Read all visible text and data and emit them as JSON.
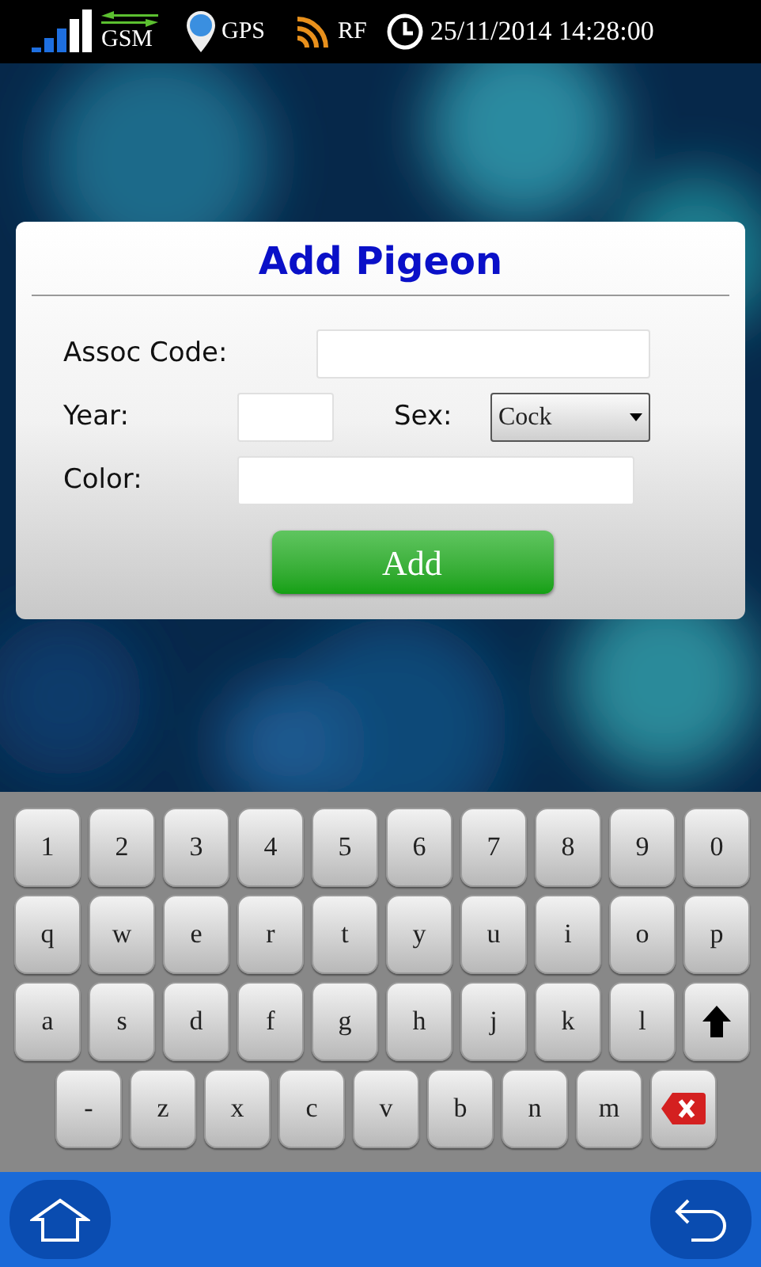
{
  "status_bar": {
    "network": "GSM",
    "gps": "GPS",
    "rf": "RF",
    "datetime": "25/11/2014 14:28:00"
  },
  "dialog": {
    "title": "Add Pigeon",
    "fields": [
      {
        "kind": "text",
        "label": "Assoc Code:"
      },
      {
        "kind": "year",
        "label": "Year:"
      },
      {
        "kind": "select",
        "label": "Sex:",
        "value": "Cock"
      },
      {
        "kind": "text",
        "label": "Color:"
      }
    ],
    "button": "Add"
  },
  "keyboard": {
    "rows": [
      [
        {
          "kind": "char",
          "label": "1"
        },
        {
          "kind": "char",
          "label": "2"
        },
        {
          "kind": "char",
          "label": "3"
        },
        {
          "kind": "char",
          "label": "4"
        },
        {
          "kind": "char",
          "label": "5"
        },
        {
          "kind": "char",
          "label": "6"
        },
        {
          "kind": "char",
          "label": "7"
        },
        {
          "kind": "char",
          "label": "8"
        },
        {
          "kind": "char",
          "label": "9"
        },
        {
          "kind": "char",
          "label": "0"
        }
      ],
      [
        {
          "kind": "char",
          "label": "q"
        },
        {
          "kind": "char",
          "label": "w"
        },
        {
          "kind": "char",
          "label": "e"
        },
        {
          "kind": "char",
          "label": "r"
        },
        {
          "kind": "char",
          "label": "t"
        },
        {
          "kind": "char",
          "label": "y"
        },
        {
          "kind": "char",
          "label": "u"
        },
        {
          "kind": "char",
          "label": "i"
        },
        {
          "kind": "char",
          "label": "o"
        },
        {
          "kind": "char",
          "label": "p"
        }
      ],
      [
        {
          "kind": "char",
          "label": "a"
        },
        {
          "kind": "char",
          "label": "s"
        },
        {
          "kind": "char",
          "label": "d"
        },
        {
          "kind": "char",
          "label": "f"
        },
        {
          "kind": "char",
          "label": "g"
        },
        {
          "kind": "char",
          "label": "h"
        },
        {
          "kind": "char",
          "label": "j"
        },
        {
          "kind": "char",
          "label": "k"
        },
        {
          "kind": "char",
          "label": "l"
        },
        {
          "kind": "shift"
        }
      ],
      [
        {
          "kind": "char",
          "label": "-"
        },
        {
          "kind": "char",
          "label": "z"
        },
        {
          "kind": "char",
          "label": "x"
        },
        {
          "kind": "char",
          "label": "c"
        },
        {
          "kind": "char",
          "label": "v"
        },
        {
          "kind": "char",
          "label": "b"
        },
        {
          "kind": "char",
          "label": "n"
        },
        {
          "kind": "char",
          "label": "m"
        },
        {
          "kind": "backspace"
        }
      ]
    ]
  }
}
